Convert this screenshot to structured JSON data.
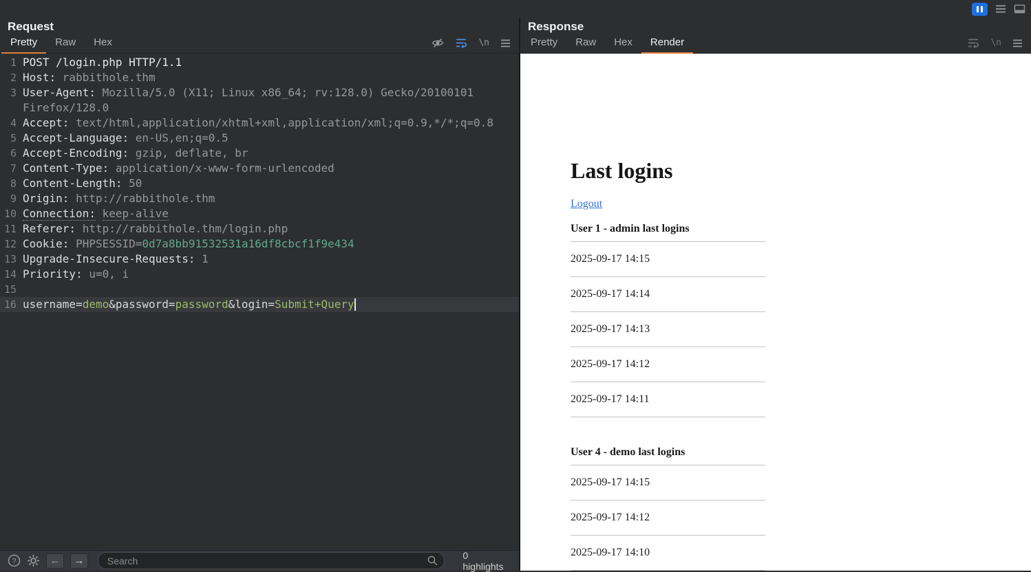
{
  "request": {
    "title": "Request",
    "tabs": [
      {
        "label": "Pretty",
        "active": true
      },
      {
        "label": "Raw"
      },
      {
        "label": "Hex"
      }
    ],
    "newline_glyph": "\\n",
    "lines": [
      {
        "n": "1",
        "segs": [
          [
            "m",
            "POST /login.php HTTP/1.1"
          ]
        ]
      },
      {
        "n": "2",
        "segs": [
          [
            "h",
            "Host: "
          ],
          [
            "v",
            "rabbithole.thm"
          ]
        ]
      },
      {
        "n": "3",
        "segs": [
          [
            "h",
            "User-Agent: "
          ],
          [
            "v",
            "Mozilla/5.0 (X11; Linux x86_64; rv:128.0) Gecko/20100101 Firefox/128.0"
          ]
        ]
      },
      {
        "n": "4",
        "segs": [
          [
            "h",
            "Accept: "
          ],
          [
            "v",
            "text/html,application/xhtml+xml,application/xml;q=0.9,*/*;q=0.8"
          ]
        ]
      },
      {
        "n": "5",
        "segs": [
          [
            "h",
            "Accept-Language: "
          ],
          [
            "v",
            "en-US,en;q=0.5"
          ]
        ]
      },
      {
        "n": "6",
        "segs": [
          [
            "h",
            "Accept-Encoding: "
          ],
          [
            "v",
            "gzip, deflate, br"
          ]
        ]
      },
      {
        "n": "7",
        "segs": [
          [
            "h",
            "Content-Type: "
          ],
          [
            "v",
            "application/x-www-form-urlencoded"
          ]
        ]
      },
      {
        "n": "8",
        "segs": [
          [
            "h",
            "Content-Length: "
          ],
          [
            "v",
            "50"
          ]
        ]
      },
      {
        "n": "9",
        "segs": [
          [
            "h",
            "Origin: "
          ],
          [
            "v",
            "http://rabbithole.thm"
          ]
        ]
      },
      {
        "n": "10",
        "segs": [
          [
            "hu",
            "Connection:"
          ],
          [
            "v",
            " "
          ],
          [
            "vu",
            "keep-alive"
          ]
        ]
      },
      {
        "n": "11",
        "segs": [
          [
            "h",
            "Referer: "
          ],
          [
            "v",
            "http://rabbithole.thm/login.php"
          ]
        ]
      },
      {
        "n": "12",
        "segs": [
          [
            "h",
            "Cookie: "
          ],
          [
            "v",
            "PHPSESSID="
          ],
          [
            "c",
            "0d7a8bb91532531a16df8cbcf1f9e434"
          ]
        ]
      },
      {
        "n": "13",
        "segs": [
          [
            "h",
            "Upgrade-Insecure-Requests: "
          ],
          [
            "v",
            "1"
          ]
        ]
      },
      {
        "n": "14",
        "segs": [
          [
            "h",
            "Priority: "
          ],
          [
            "v",
            "u=0, i"
          ]
        ]
      },
      {
        "n": "15",
        "segs": []
      },
      {
        "n": "16",
        "segs": [
          [
            "p",
            "username="
          ],
          [
            "g",
            "demo"
          ],
          [
            "p",
            "&password="
          ],
          [
            "g",
            "password"
          ],
          [
            "p",
            "&login="
          ],
          [
            "g",
            "Submit+Query"
          ]
        ],
        "cursor": true,
        "active": true
      }
    ]
  },
  "response": {
    "title": "Response",
    "tabs": [
      {
        "label": "Pretty"
      },
      {
        "label": "Raw"
      },
      {
        "label": "Hex"
      },
      {
        "label": "Render",
        "active": true
      }
    ],
    "newline_glyph": "\\n",
    "render": {
      "heading": "Last logins",
      "logout_link": "Logout",
      "tables": [
        {
          "header": "User 1 - admin last logins",
          "rows": [
            "2025-09-17 14:15",
            "2025-09-17 14:14",
            "2025-09-17 14:13",
            "2025-09-17 14:12",
            "2025-09-17 14:11"
          ]
        },
        {
          "header": "User 4 - demo last logins",
          "rows": [
            "2025-09-17 14:15",
            "2025-09-17 14:12",
            "2025-09-17 14:10"
          ]
        }
      ]
    }
  },
  "statusbar": {
    "search_placeholder": "Search",
    "highlights_label": "0 highlights"
  },
  "colors": {
    "accent_orange": "#e07f3c",
    "pause_blue": "#1f6fe0",
    "link_blue": "#2f6ed6",
    "value_green": "#9cba68",
    "cookie_green": "#61a98c"
  }
}
